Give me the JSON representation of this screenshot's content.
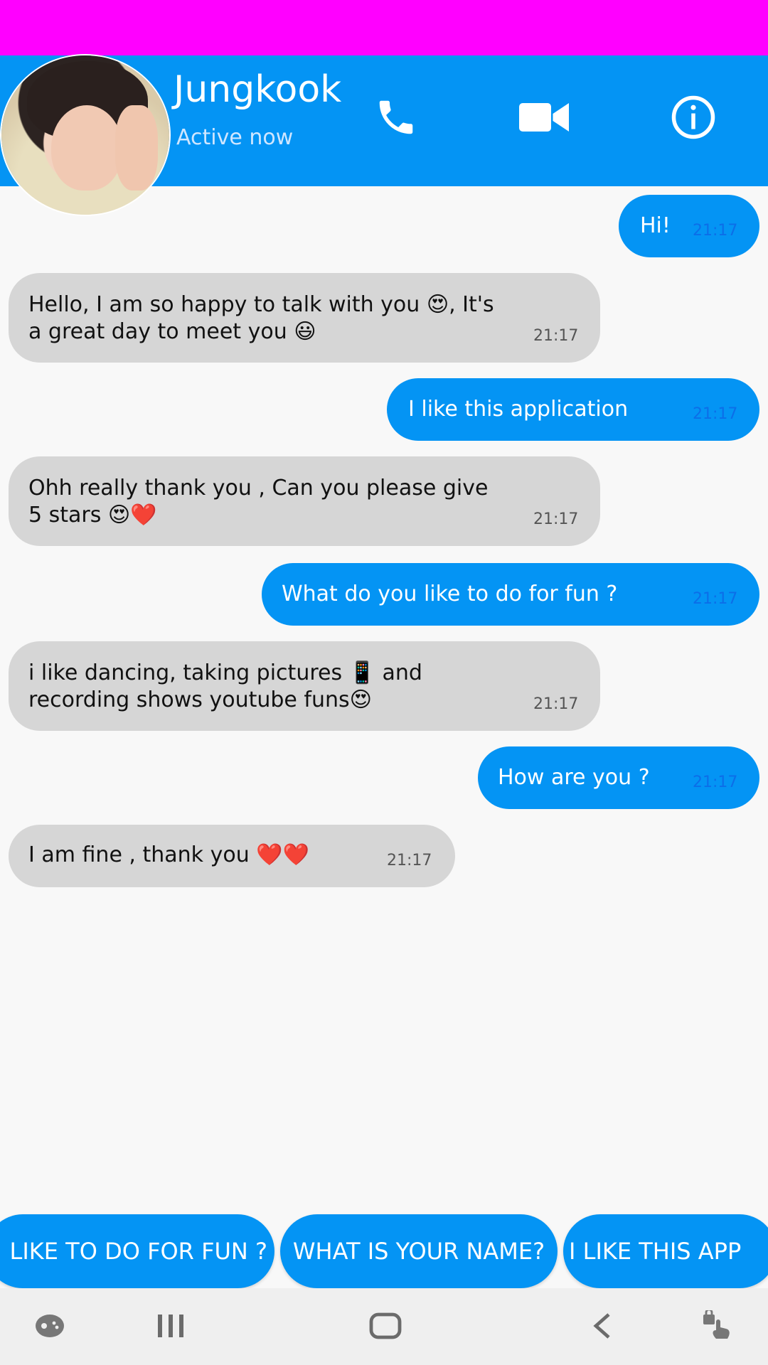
{
  "header": {
    "name": "Jungkook",
    "status": "Active now",
    "color": "#0494f4"
  },
  "messages": [
    {
      "side": "sent",
      "text": "Hi!",
      "time": "21:17"
    },
    {
      "side": "received",
      "text": "Hello, I am so happy to talk with you 😍, It's a great day to meet you 😃",
      "time": "21:17"
    },
    {
      "side": "sent",
      "text": "I like this application",
      "time": "21:17"
    },
    {
      "side": "received",
      "text": "Ohh really thank you , Can you please give 5 stars 😍❤️",
      "time": "21:17"
    },
    {
      "side": "sent",
      "text": "What do you like to do for fun ?",
      "time": "21:17"
    },
    {
      "side": "received",
      "text": "i like dancing, taking pictures 📱 and recording shows youtube funs😍",
      "time": "21:17"
    },
    {
      "side": "sent",
      "text": "How are you ?",
      "time": "21:17"
    },
    {
      "side": "received",
      "text": "I am fine , thank you ❤️❤️",
      "time": "21:17"
    }
  ],
  "quick_replies": [
    "LIKE TO DO FOR FUN ?",
    "WHAT IS YOUR NAME?",
    "I LIKE THIS APP"
  ],
  "icons": {
    "phone": "phone-icon",
    "video": "video-camera-icon",
    "info": "info-icon",
    "game": "game-icon",
    "recents": "recents-icon",
    "home": "home-icon",
    "back": "back-icon",
    "accessibility": "touch-icon"
  }
}
